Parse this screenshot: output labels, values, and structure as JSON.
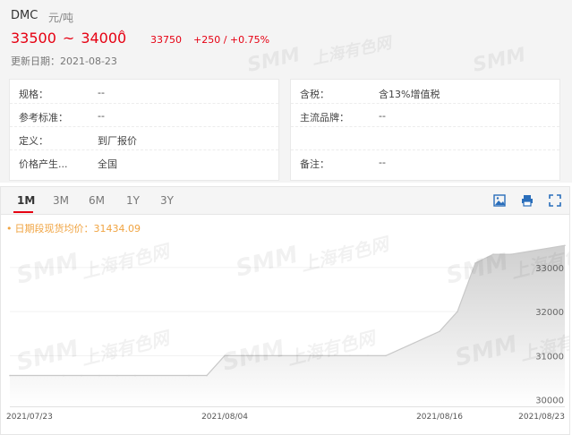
{
  "product": {
    "name": "DMC",
    "unit": "元/吨",
    "price_low": "33500",
    "range_sep": "~",
    "price_high": "34000",
    "up_mark": "^",
    "avg_price": "33750",
    "change": "+250 / +0.75%",
    "update_label": "更新日期：",
    "update_date": "2021-08-23"
  },
  "info_left": [
    {
      "label": "规格：",
      "value": "--"
    },
    {
      "label": "参考标准：",
      "value": "--"
    },
    {
      "label": "定义：",
      "value": "到厂报价"
    },
    {
      "label": "价格产生...",
      "value": "全国"
    }
  ],
  "info_right": [
    {
      "label": "含税：",
      "value": "含13%增值税"
    },
    {
      "label": "主流品牌：",
      "value": "--"
    },
    {
      "label": "",
      "value": ""
    },
    {
      "label": "备注：",
      "value": "--"
    }
  ],
  "tabs": [
    "1M",
    "3M",
    "6M",
    "1Y",
    "3Y"
  ],
  "active_tab": "1M",
  "toolbar": {
    "icons": [
      "image-icon",
      "print-icon",
      "fullscreen-icon"
    ]
  },
  "watermark": {
    "brand": "SMM",
    "text": "上海有色网"
  },
  "chart_data": {
    "type": "area",
    "title": "",
    "avg_label": "日期段现货均价：",
    "avg_value": "31434.09",
    "x_ticks": [
      "2021/07/23",
      "2021/08/04",
      "2021/08/16",
      "2021/08/23"
    ],
    "y_ticks": [
      30000,
      31000,
      32000,
      33000
    ],
    "ylim": [
      29850,
      33850
    ],
    "x": [
      "2021-07-23",
      "2021-07-26",
      "2021-07-27",
      "2021-07-28",
      "2021-07-29",
      "2021-07-30",
      "2021-08-02",
      "2021-08-03",
      "2021-08-04",
      "2021-08-05",
      "2021-08-06",
      "2021-08-09",
      "2021-08-10",
      "2021-08-11",
      "2021-08-12",
      "2021-08-13",
      "2021-08-16",
      "2021-08-17",
      "2021-08-18",
      "2021-08-19",
      "2021-08-20",
      "2021-08-23"
    ],
    "values": [
      30550,
      30550,
      30550,
      30550,
      30550,
      30550,
      30550,
      30550,
      31000,
      31000,
      31000,
      31000,
      31000,
      31000,
      31000,
      31000,
      31550,
      32000,
      33100,
      33300,
      33300,
      33500
    ],
    "grid": true,
    "colors": {
      "fill": "#d9d9d9",
      "line": "#cccccc",
      "avg": "#f0a442",
      "accent": "#e60012"
    }
  }
}
